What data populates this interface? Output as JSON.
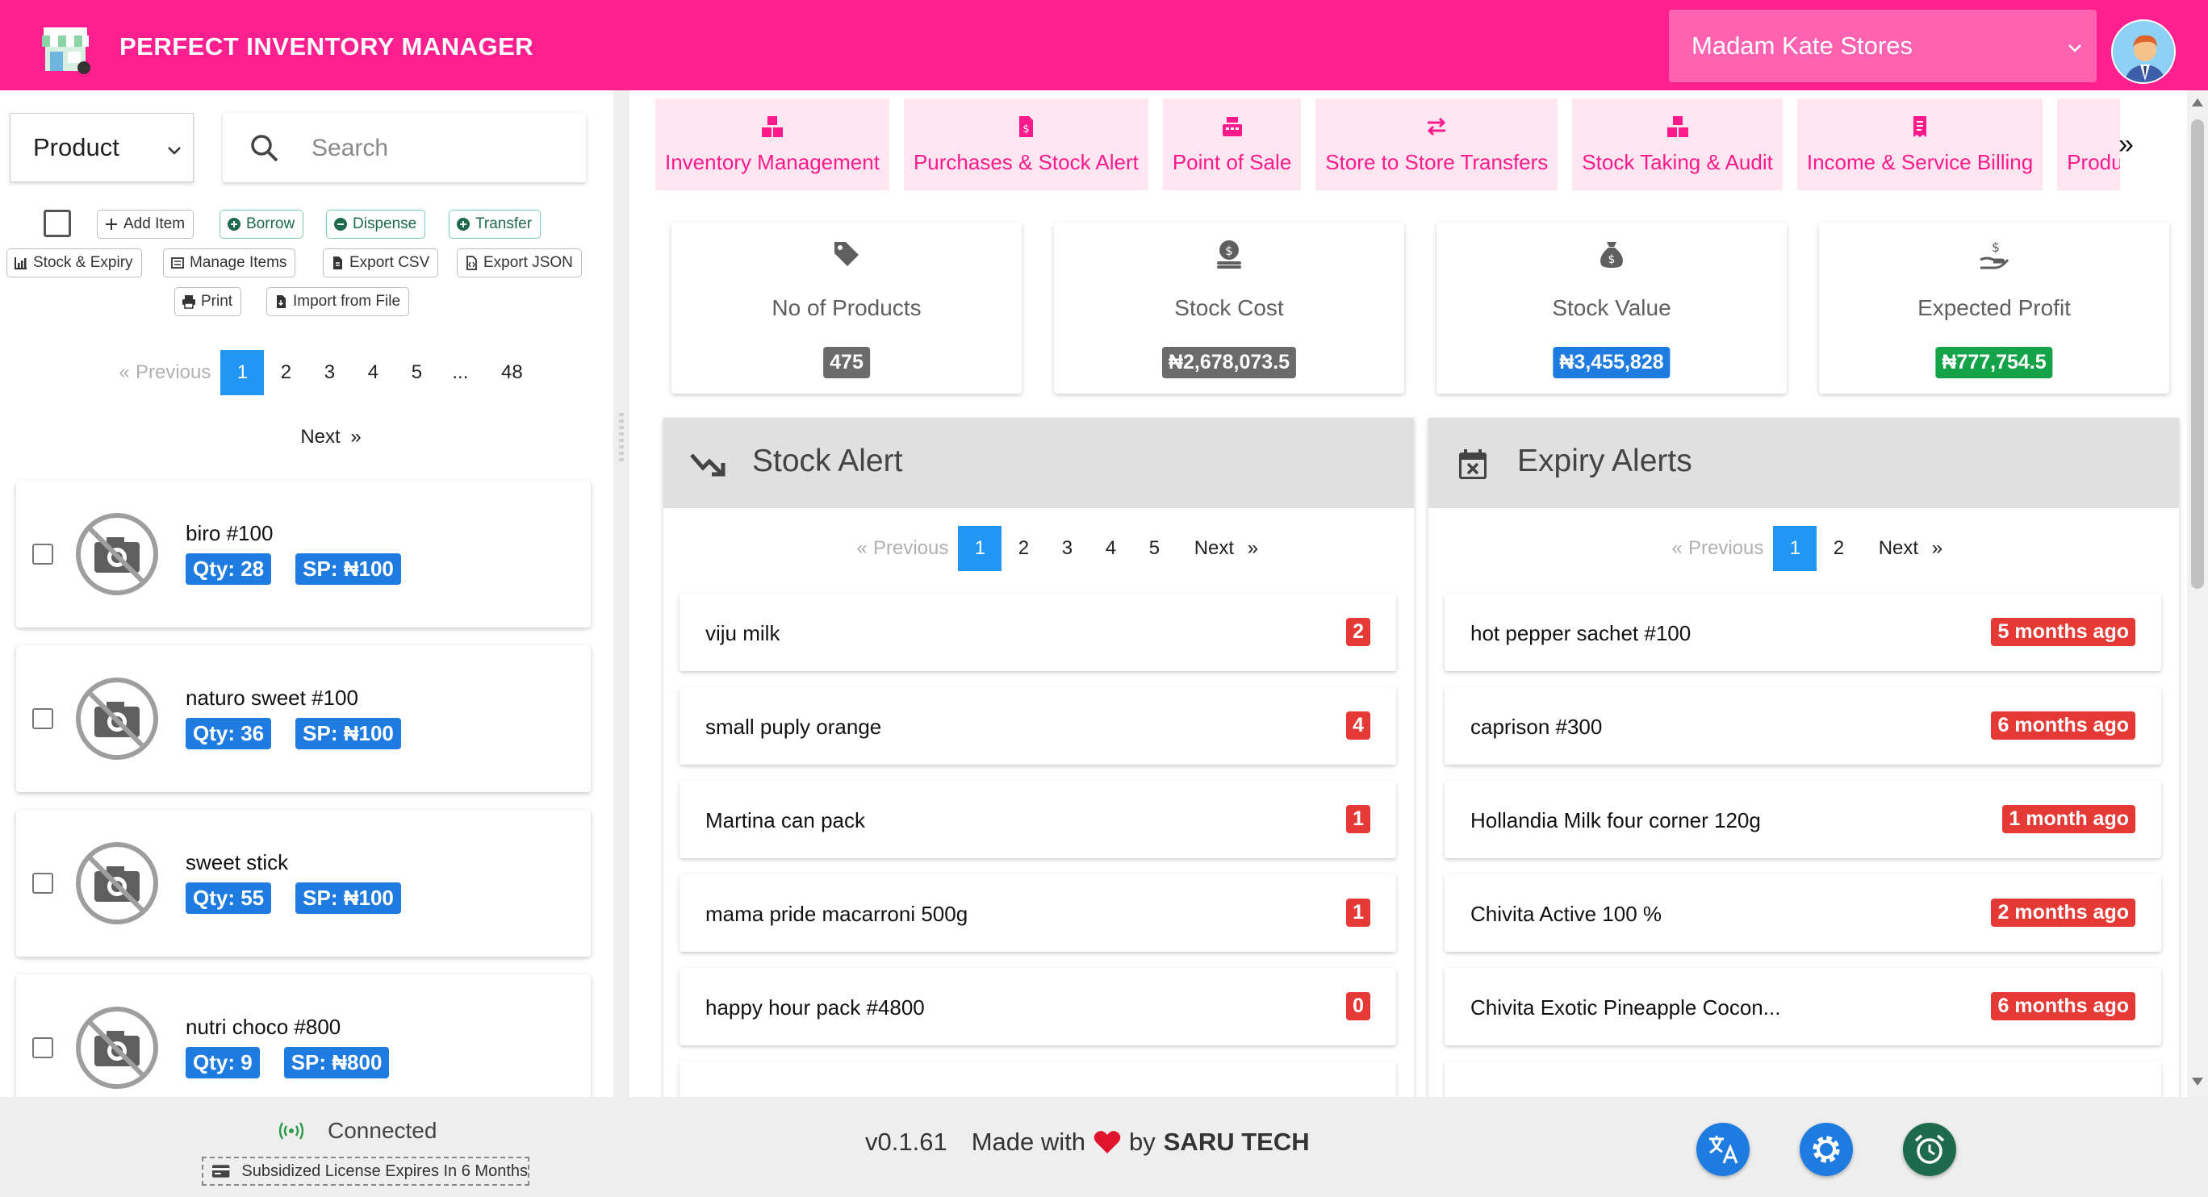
{
  "header": {
    "title": "PERFECT INVENTORY MANAGER",
    "store": "Madam Kate Stores",
    "brand_color": "#ff1f8e"
  },
  "left": {
    "category_select": "Product",
    "search_placeholder": "Search",
    "toolbar": {
      "add_item": "Add Item",
      "borrow": "Borrow",
      "dispense": "Dispense",
      "transfer": "Transfer",
      "stock_expiry": "Stock & Expiry",
      "manage_items": "Manage Items",
      "export_csv": "Export CSV",
      "export_json": "Export JSON",
      "print": "Print",
      "import_file": "Import from File"
    },
    "pagination": {
      "prev_mark": "«",
      "previous": "Previous",
      "pages": [
        "1",
        "2",
        "3",
        "4",
        "5",
        "...",
        "48"
      ],
      "next": "Next",
      "next_mark": "»"
    },
    "products": [
      {
        "name": "biro #100",
        "qty": "Qty: 28",
        "sp": "SP: ₦100"
      },
      {
        "name": "naturo sweet #100",
        "qty": "Qty: 36",
        "sp": "SP: ₦100"
      },
      {
        "name": "sweet stick",
        "qty": "Qty: 55",
        "sp": "SP: ₦100"
      },
      {
        "name": "nutri choco #800",
        "qty": "Qty: 9",
        "sp": "SP: ₦800"
      }
    ]
  },
  "tabs": [
    "Inventory Management",
    "Purchases & Stock Alert",
    "Point of Sale",
    "Store to Store Transfers",
    "Stock Taking & Audit",
    "Income & Service Billing",
    "Produ"
  ],
  "tabs_more": "»",
  "stats": [
    {
      "label": "No of Products",
      "value": "475",
      "color": "#6b6b6b",
      "icon": "tag-icon"
    },
    {
      "label": "Stock Cost",
      "value": "₦2,678,073.5",
      "color": "#6b6b6b",
      "icon": "coin-stack-icon"
    },
    {
      "label": "Stock Value",
      "value": "₦3,455,828",
      "color": "#1e7be0",
      "icon": "money-bag-icon"
    },
    {
      "label": "Expected Profit",
      "value": "₦777,754.5",
      "color": "#15a34a",
      "icon": "hand-money-icon"
    }
  ],
  "stock_alert": {
    "title": "Stock Alert",
    "pagination": {
      "prev_mark": "«",
      "previous": "Previous",
      "pages": [
        "1",
        "2",
        "3",
        "4",
        "5"
      ],
      "next": "Next",
      "next_mark": "»"
    },
    "items": [
      {
        "name": "viju milk",
        "count": "2"
      },
      {
        "name": "small puply orange",
        "count": "4"
      },
      {
        "name": "Martina can pack",
        "count": "1"
      },
      {
        "name": "mama pride macarroni 500g",
        "count": "1"
      },
      {
        "name": "happy hour pack #4800",
        "count": "0"
      }
    ]
  },
  "expiry_alerts": {
    "title": "Expiry Alerts",
    "pagination": {
      "prev_mark": "«",
      "previous": "Previous",
      "pages": [
        "1",
        "2"
      ],
      "next": "Next",
      "next_mark": "»"
    },
    "items": [
      {
        "name": "hot pepper sachet #100",
        "when": "5 months ago"
      },
      {
        "name": "caprison #300",
        "when": "6 months ago"
      },
      {
        "name": "Hollandia Milk four corner 120g",
        "when": "1 month ago"
      },
      {
        "name": "Chivita Active 100 %",
        "when": "2 months ago"
      },
      {
        "name": "Chivita Exotic Pineapple Cocon...",
        "when": "6 months ago"
      }
    ]
  },
  "footer": {
    "status": "Connected",
    "license": "Subsidized License Expires In 6 Months",
    "version": "v0.1.61",
    "made_with": "Made with",
    "by": "by",
    "company": "SARU TECH"
  }
}
